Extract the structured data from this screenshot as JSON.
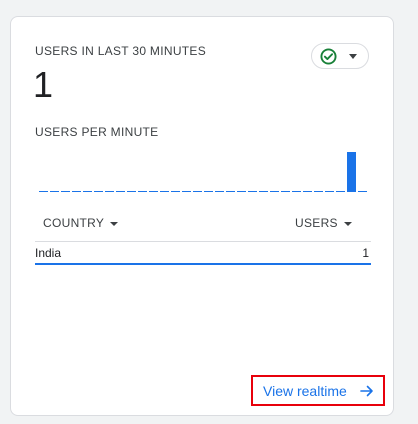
{
  "card": {
    "heading": "USERS IN LAST 30 MINUTES",
    "users_count": "1",
    "status_icon": "check-circle-icon",
    "status_color": "#188038",
    "subheading": "USERS PER MINUTE"
  },
  "chart_data": {
    "type": "bar",
    "xlabel": "",
    "ylabel": "",
    "values": [
      0,
      0,
      0,
      0,
      0,
      0,
      0,
      0,
      0,
      0,
      0,
      0,
      0,
      0,
      0,
      0,
      0,
      0,
      0,
      0,
      0,
      0,
      0,
      0,
      0,
      0,
      0,
      0,
      1,
      0
    ],
    "ylim": [
      0,
      1
    ],
    "bar_color": "#1a73e8",
    "baseline_color": "#1a73e8"
  },
  "table": {
    "columns": [
      "COUNTRY",
      "USERS"
    ],
    "rows": [
      {
        "country": "India",
        "users": "1"
      }
    ]
  },
  "footer": {
    "link_label": "View realtime",
    "link_icon": "arrow-right-icon",
    "accent": "#1a73e8",
    "highlight": "#e8000b"
  }
}
